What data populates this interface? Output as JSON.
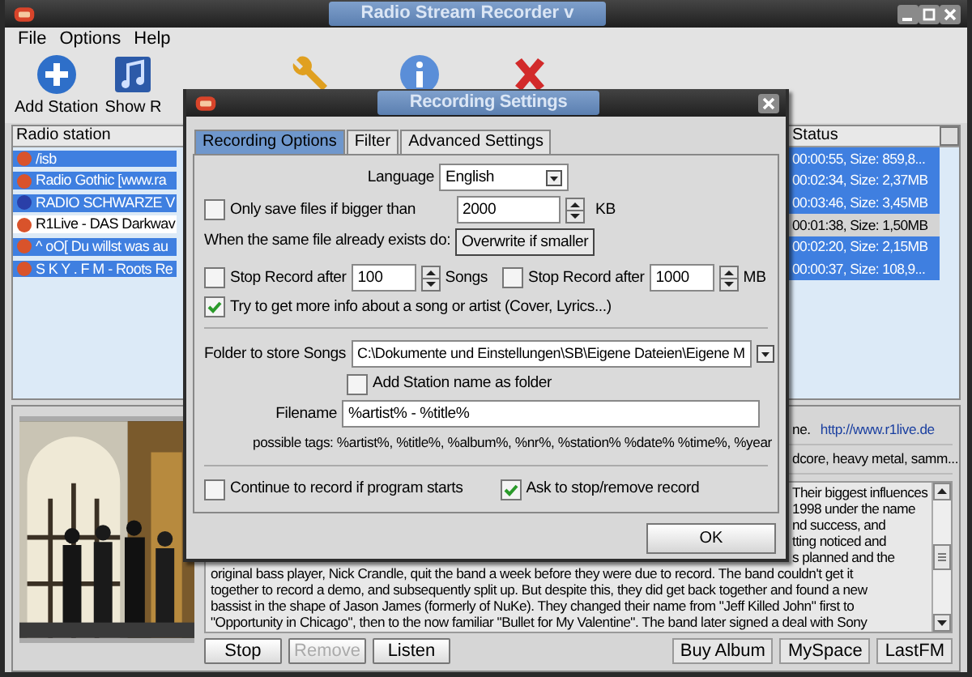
{
  "window": {
    "title": "Radio Stream Recorder v"
  },
  "menu": [
    "File",
    "Options",
    "Help"
  ],
  "toolbar": [
    "Add Station",
    "Show R"
  ],
  "stations": {
    "columns": [
      "Radio station",
      "Status"
    ],
    "rows": [
      {
        "name": "/isb",
        "status": "00:00:55, Size: 859,8...",
        "selected": true,
        "color": "#d9532b"
      },
      {
        "name": "Radio Gothic [www.ra",
        "status": "00:02:34, Size: 2,37MB",
        "selected": true,
        "color": "#d9532b"
      },
      {
        "name": "RADIO SCHWARZE V",
        "status": "00:03:46, Size: 3,45MB",
        "selected": true,
        "color": "#2a3fa8"
      },
      {
        "name": "R1Live - DAS Darkwav",
        "status": "00:01:38, Size: 1,50MB",
        "selected": false,
        "color": "#d9532b"
      },
      {
        "name": "^ oO[ Du willst was au",
        "status": "00:02:20, Size: 2,15MB",
        "selected": true,
        "color": "#d9532b"
      },
      {
        "name": "S K Y . F M - Roots Re",
        "status": "00:00:37, Size: 108,9...",
        "selected": true,
        "color": "#d9532b"
      }
    ]
  },
  "details": {
    "info": [
      {
        "text": "ne.",
        "link": "http://www.r1live.de"
      },
      {
        "text": "dcore, heavy metal, samm..."
      }
    ],
    "biography": [
      {
        "kind": "fragment",
        "text": "Their biggest influences"
      },
      {
        "kind": "fragment",
        "text": "1998 under the name"
      },
      {
        "kind": "fragment",
        "text": "nd success, and"
      },
      {
        "kind": "fragment",
        "text": "tting noticed and"
      },
      {
        "kind": "fragment",
        "text": "s planned and the"
      },
      {
        "kind": "full",
        "text": "original bass player, Nick Crandle, quit the band a week before they were due to record. The band couldn't get it"
      },
      {
        "kind": "full",
        "text": "together to record a demo, and subsequently split up. But despite this, they did get back together and found a new"
      },
      {
        "kind": "full",
        "text": "bassist in the shape of Jason James (formerly of NuKe). They changed their name from \"Jeff Killed John\" first to"
      },
      {
        "kind": "full",
        "text": "\"Opportunity in Chicago\", then to the now familiar \"Bullet for My Valentine\". The band later signed a deal with Sony"
      }
    ],
    "buttons": [
      {
        "label": "Stop",
        "disabled": false
      },
      {
        "label": "Remove",
        "disabled": true
      },
      {
        "label": "Listen",
        "disabled": false
      }
    ],
    "links": [
      "Buy Album",
      "MySpace",
      "LastFM"
    ]
  },
  "dialog": {
    "title": "Recording Settings",
    "tabs": [
      {
        "label": "Recording Options",
        "selected": true
      },
      {
        "label": "Filter",
        "selected": false
      },
      {
        "label": "Advanced Settings",
        "selected": false
      }
    ],
    "language": {
      "label": "Language",
      "value": "English"
    },
    "min_size": {
      "label": "Only save files if bigger than",
      "checked": false,
      "value": "2000",
      "unit": "KB"
    },
    "exists": {
      "label": "When the same file already exists do:",
      "button": "Overwrite if smaller"
    },
    "stop_songs": {
      "label": "Stop Record after",
      "checked": false,
      "value": "100",
      "unit": "Songs"
    },
    "stop_size": {
      "label": "Stop Record after",
      "checked": false,
      "value": "1000",
      "unit": "MB"
    },
    "more_info": {
      "label": "Try to get more info about a song or artist (Cover, Lyrics...)",
      "checked": true
    },
    "folder": {
      "label": "Folder to store Songs",
      "value": "C:\\Dokumente und Einstellungen\\SB\\Eigene Dateien\\Eigene M"
    },
    "station_folder": {
      "label": "Add Station name as folder",
      "checked": false
    },
    "filename": {
      "label": "Filename",
      "value": "%artist% - %title%"
    },
    "tags": "possible tags: %artist%, %title%, %album%, %nr%, %station% %date% %time%, %year",
    "continue": {
      "label": "Continue to record if program starts",
      "checked": false
    },
    "ask": {
      "label": "Ask to stop/remove record",
      "checked": true
    },
    "ok": "OK"
  }
}
